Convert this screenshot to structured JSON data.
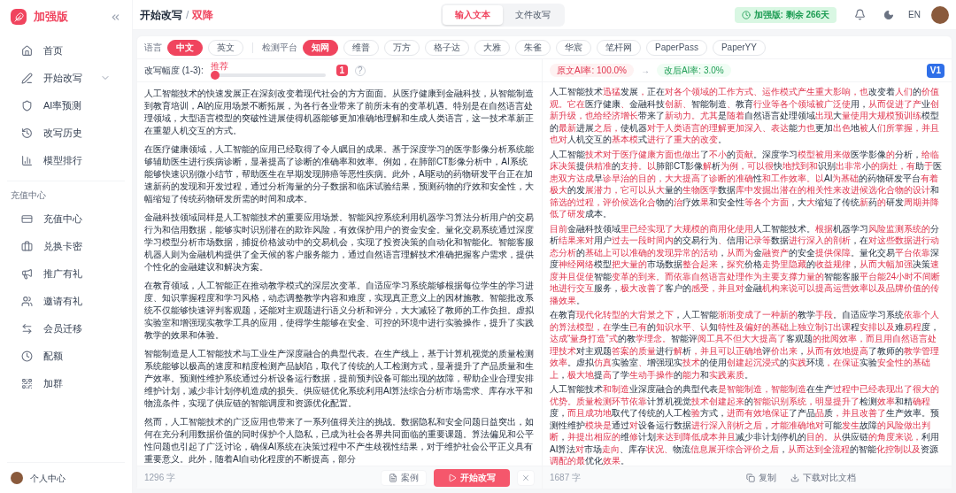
{
  "sidebar": {
    "logo": "加强版",
    "items": [
      {
        "label": "首页",
        "kind": "link",
        "selected": false
      },
      {
        "label": "开始改写",
        "kind": "group",
        "selected": false
      },
      {
        "label": "AI率预测",
        "kind": "link",
        "selected": false
      },
      {
        "label": "改写历史",
        "kind": "link",
        "selected": false
      },
      {
        "label": "模型排行",
        "kind": "link",
        "selected": false
      }
    ],
    "section_label": "充值中心",
    "section_items": [
      {
        "label": "充值中心",
        "selected": false
      },
      {
        "label": "兑换卡密",
        "selected": false
      },
      {
        "label": "推广有礼",
        "selected": false
      },
      {
        "label": "邀请有礼",
        "selected": false
      },
      {
        "label": "会员迁移",
        "selected": false
      },
      {
        "label": "配额",
        "selected": false
      },
      {
        "label": "加群",
        "selected": false
      }
    ],
    "user": "个人中心"
  },
  "header": {
    "breadcrumb": "开始改写",
    "separator": "/",
    "current": "双降",
    "mode_tabs": [
      {
        "label": "输入文本",
        "selected": true
      },
      {
        "label": "文件改写",
        "selected": false
      }
    ],
    "plan_badge": "加强版: 剩余 266天",
    "language_toggle": "EN"
  },
  "filters": {
    "language_label": "语言",
    "languages": [
      {
        "label": "中文",
        "selected": true
      },
      {
        "label": "英文",
        "selected": false
      }
    ],
    "platform_label": "检测平台",
    "platforms": [
      {
        "label": "知网",
        "selected": true
      },
      {
        "label": "维普",
        "selected": false
      },
      {
        "label": "万方",
        "selected": false
      },
      {
        "label": "格子达",
        "selected": false
      },
      {
        "label": "大雅",
        "selected": false
      },
      {
        "label": "朱雀",
        "selected": false
      },
      {
        "label": "华宸",
        "selected": false
      },
      {
        "label": "笔杆网",
        "selected": false
      },
      {
        "label": "PaperPass",
        "selected": false
      },
      {
        "label": "PaperYY",
        "selected": false
      }
    ]
  },
  "input_panel": {
    "strength_label": "改写幅度 (1-3):",
    "strength_hint": "推荐",
    "strength": {
      "level": 0
    },
    "strength_value": "1",
    "help": "?",
    "paragraphs": [
      "人工智能技术的快速发展正在深刻改变着现代社会的方方面面。从医疗健康到金融科技，从智能制造到教育培训，AI的应用场景不断拓展，为各行各业带来了前所未有的变革机遇。特别是在自然语言处理领域，大型语言模型的突破性进展使得机器能够更加准确地理解和生成人类语言，这一技术革新正在重塑人机交互的方式。",
      "在医疗健康领域，人工智能的应用已经取得了令人瞩目的成果。基于深度学习的医学影像分析系统能够辅助医生进行疾病诊断，显著提高了诊断的准确率和效率。例如，在肺部CT影像分析中，AI系统能够快速识别微小结节，帮助医生在早期发现肺癌等恶性疾病。此外，AI驱动的药物研发平台正在加速新药的发现和开发过程，通过分析海量的分子数据和临床试验结果，预测药物的疗效和安全性，大幅缩短了传统药物研发所需的时间和成本。",
      "金融科技领域同样是人工智能技术的重要应用场景。智能风控系统利用机器学习算法分析用户的交易行为和信用数据，能够实时识别潜在的欺诈风险，有效保护用户的资金安全。量化交易系统通过深度学习模型分析市场数据，捕捉价格波动中的交易机会，实现了投资决策的自动化和智能化。智能客服机器人则为金融机构提供了全天候的客户服务能力，通过自然语言理解技术准确把握客户需求，提供个性化的金融建议和解决方案。",
      "在教育领域，人工智能正在推动教学模式的深层次变革。自适应学习系统能够根据每位学生的学习进度、知识掌握程度和学习风格，动态调整教学内容和难度，实现真正意义上的因材施教。智能批改系统不仅能够快速评判客观题，还能对主观题进行语义分析和评分，大大减轻了教师的工作负担。虚拟实验室和增强现实教学工具的应用，使得学生能够在安全、可控的环境中进行实验操作，提升了实践教学的效果和体验。",
      "智能制造是人工智能技术与工业生产深度融合的典型代表。在生产线上，基于计算机视觉的质量检测系统能够以极高的速度和精度检测产品缺陷，取代了传统的人工检测方式，显著提升了产品质量和生产效率。预测性维护系统通过分析设备运行数据，提前预判设备可能出现的故障，帮助企业合理安排维护计划，减少非计划停机造成的损失。供应链优化系统利用AI算法综合分析市场需求、库存水平和物流条件，实现了供应链的智能调度和资源优化配置。",
      "然而，人工智能技术的广泛应用也带来了一系列值得关注的挑战。数据隐私和安全问题日益突出，如何在充分利用数据价值的同时保护个人隐私，已成为社会各界共同面临的重要课题。算法偏见和公平性问题也引起了广泛讨论，确保AI系统在决策过程中不产生歧视性结果，对于维护社会公平正义具有重要意义。此外，随着AI自动化程度的不断提高，部分"
    ],
    "count": "1296 字",
    "sample_button": "案例",
    "start_button": "开始改写"
  },
  "output_panel": {
    "original_rate": "原文AI率: 100.0%",
    "arrow": "→",
    "new_rate": "改后AI率: 3.0%",
    "version": "V1",
    "paragraphs": [
      [
        {
          "text": "人工智能技术",
          "changed": false
        },
        {
          "text": "迅猛",
          "changed": true
        },
        {
          "text": "发展",
          "changed": false
        },
        {
          "text": "，",
          "changed": true
        },
        {
          "text": "正在",
          "changed": false
        },
        {
          "text": "对各个领域的工作方式、运作模式产生重大影响，也",
          "changed": true
        },
        {
          "text": "改变着",
          "changed": false
        },
        {
          "text": "人们",
          "changed": true
        },
        {
          "text": "的",
          "changed": false
        },
        {
          "text": "价值观。它在",
          "changed": true
        },
        {
          "text": "医疗健康",
          "changed": false
        },
        {
          "text": "、",
          "changed": true
        },
        {
          "text": "金融科技",
          "changed": false
        },
        {
          "text": "创新、",
          "changed": true
        },
        {
          "text": "智能制造",
          "changed": false
        },
        {
          "text": "、",
          "changed": true
        },
        {
          "text": "教育",
          "changed": false
        },
        {
          "text": "行业等各个领域被广泛使",
          "changed": true
        },
        {
          "text": "用，",
          "changed": false
        },
        {
          "text": "从而促进了产",
          "changed": true
        },
        {
          "text": "业",
          "changed": false
        },
        {
          "text": "创新升级，也给经济增长",
          "changed": true
        },
        {
          "text": "带来了",
          "changed": false
        },
        {
          "text": "新动力。尤其",
          "changed": true
        },
        {
          "text": "是",
          "changed": false
        },
        {
          "text": "随着",
          "changed": true
        },
        {
          "text": "自然语言处理领域",
          "changed": false
        },
        {
          "text": "出现",
          "changed": true
        },
        {
          "text": "大",
          "changed": false
        },
        {
          "text": "量使用大规模预训练",
          "changed": true
        },
        {
          "text": "模型的",
          "changed": false
        },
        {
          "text": "最新",
          "changed": true
        },
        {
          "text": "进展",
          "changed": false
        },
        {
          "text": "之后，",
          "changed": true
        },
        {
          "text": "使机器",
          "changed": false
        },
        {
          "text": "对于人类语言的理解更加深入、表达",
          "changed": true
        },
        {
          "text": "能",
          "changed": false
        },
        {
          "text": "力也",
          "changed": true
        },
        {
          "text": "更加",
          "changed": false
        },
        {
          "text": "出色",
          "changed": true
        },
        {
          "text": "地",
          "changed": false
        },
        {
          "text": "被",
          "changed": true
        },
        {
          "text": "人",
          "changed": false
        },
        {
          "text": "们所掌握，并且也对",
          "changed": true
        },
        {
          "text": "人机交互的",
          "changed": false
        },
        {
          "text": "基本模",
          "changed": true
        },
        {
          "text": "式",
          "changed": false
        },
        {
          "text": "进行了重大的改变",
          "changed": true
        },
        {
          "text": "。",
          "changed": false
        }
      ],
      [
        {
          "text": "人工智能",
          "changed": false
        },
        {
          "text": "技术对于医疗健康方面也做出",
          "changed": true
        },
        {
          "text": "了",
          "changed": false
        },
        {
          "text": "不小",
          "changed": true
        },
        {
          "text": "的",
          "changed": false
        },
        {
          "text": "贡献",
          "changed": true
        },
        {
          "text": "。深度学习",
          "changed": false
        },
        {
          "text": "模型被用来做",
          "changed": true
        },
        {
          "text": "医学影像",
          "changed": false
        },
        {
          "text": "的",
          "changed": true
        },
        {
          "text": "分析，",
          "changed": false
        },
        {
          "text": "给临床决策",
          "changed": true
        },
        {
          "text": "提",
          "changed": false
        },
        {
          "text": "供精准",
          "changed": true
        },
        {
          "text": "的",
          "changed": false
        },
        {
          "text": "支持。以",
          "changed": true
        },
        {
          "text": "肺部CT影像",
          "changed": false
        },
        {
          "text": "解",
          "changed": true
        },
        {
          "text": "析",
          "changed": false
        },
        {
          "text": "为例，可以很",
          "changed": true
        },
        {
          "text": "快",
          "changed": false
        },
        {
          "text": "地找到和",
          "changed": true
        },
        {
          "text": "识别",
          "changed": false
        },
        {
          "text": "出非常",
          "changed": true
        },
        {
          "text": "小",
          "changed": false
        },
        {
          "text": "的病灶，有",
          "changed": true
        },
        {
          "text": "助",
          "changed": false
        },
        {
          "text": "于",
          "changed": true
        },
        {
          "text": "医",
          "changed": false
        },
        {
          "text": "患双方达成",
          "changed": true
        },
        {
          "text": "早",
          "changed": false
        },
        {
          "text": "诊早治的目的，大大提高了诊断的准确",
          "changed": true
        },
        {
          "text": "性",
          "changed": false
        },
        {
          "text": "和工作效率。以",
          "changed": true
        },
        {
          "text": "AI",
          "changed": false
        },
        {
          "text": "为基础",
          "changed": true
        },
        {
          "text": "的药物研发平台",
          "changed": false
        },
        {
          "text": "有着极大",
          "changed": true
        },
        {
          "text": "的发",
          "changed": false
        },
        {
          "text": "展潜力，它可以从大",
          "changed": true
        },
        {
          "text": "量的",
          "changed": false
        },
        {
          "text": "生物医学",
          "changed": true
        },
        {
          "text": "数据",
          "changed": false
        },
        {
          "text": "库中发掘出潜在的相关性来改进候选化合物的设计",
          "changed": true
        },
        {
          "text": "和",
          "changed": false
        },
        {
          "text": "筛选的过程，评价候选化合",
          "changed": true
        },
        {
          "text": "物的",
          "changed": false
        },
        {
          "text": "治",
          "changed": true
        },
        {
          "text": "疗效",
          "changed": false
        },
        {
          "text": "果",
          "changed": true
        },
        {
          "text": "和安全性",
          "changed": false
        },
        {
          "text": "等各个方面",
          "changed": true
        },
        {
          "text": "，大",
          "changed": false
        },
        {
          "text": "大",
          "changed": true
        },
        {
          "text": "缩短了传统",
          "changed": false
        },
        {
          "text": "新",
          "changed": true
        },
        {
          "text": "药",
          "changed": false
        },
        {
          "text": "的",
          "changed": true
        },
        {
          "text": "研发",
          "changed": false
        },
        {
          "text": "周期并降低了研发",
          "changed": true
        },
        {
          "text": "成本。",
          "changed": false
        }
      ],
      [
        {
          "text": "目前",
          "changed": true
        },
        {
          "text": "金融科技领域",
          "changed": false
        },
        {
          "text": "里已经实现了大规模的商用化使用",
          "changed": true
        },
        {
          "text": "人工智能技术。",
          "changed": false
        },
        {
          "text": "根据",
          "changed": true
        },
        {
          "text": "机器学习",
          "changed": false
        },
        {
          "text": "风险监测系统的",
          "changed": true
        },
        {
          "text": "分析",
          "changed": false
        },
        {
          "text": "结果来对",
          "changed": true
        },
        {
          "text": "用户",
          "changed": false
        },
        {
          "text": "过去一段时间内",
          "changed": true
        },
        {
          "text": "的交易行为",
          "changed": false
        },
        {
          "text": "、",
          "changed": true
        },
        {
          "text": "信用",
          "changed": false
        },
        {
          "text": "记录等",
          "changed": true
        },
        {
          "text": "数据",
          "changed": false
        },
        {
          "text": "进行深入的剖析",
          "changed": true
        },
        {
          "text": "，在",
          "changed": false
        },
        {
          "text": "对这些数据进行动态分析",
          "changed": true
        },
        {
          "text": "的",
          "changed": false
        },
        {
          "text": "基础上可以准确的发现异常的活动",
          "changed": true
        },
        {
          "text": "，",
          "changed": false
        },
        {
          "text": "从而为",
          "changed": true
        },
        {
          "text": "金",
          "changed": false
        },
        {
          "text": "融资产",
          "changed": true
        },
        {
          "text": "的安全",
          "changed": false
        },
        {
          "text": "提供保障",
          "changed": true
        },
        {
          "text": "。量化交易",
          "changed": false
        },
        {
          "text": "平台依靠",
          "changed": true
        },
        {
          "text": "深度",
          "changed": false
        },
        {
          "text": "神经网络",
          "changed": true
        },
        {
          "text": "模型",
          "changed": false
        },
        {
          "text": "把大量的",
          "changed": true
        },
        {
          "text": "市场数据",
          "changed": false
        },
        {
          "text": "整合起来",
          "changed": true
        },
        {
          "text": "，",
          "changed": false
        },
        {
          "text": "探究",
          "changed": true
        },
        {
          "text": "价格",
          "changed": false
        },
        {
          "text": "走势里隐藏",
          "changed": true
        },
        {
          "text": "的",
          "changed": false
        },
        {
          "text": "收益规律",
          "changed": true
        },
        {
          "text": "，",
          "changed": false
        },
        {
          "text": "从而大幅加强",
          "changed": true
        },
        {
          "text": "决策",
          "changed": false
        },
        {
          "text": "速度并且促使",
          "changed": true
        },
        {
          "text": "智能",
          "changed": false
        },
        {
          "text": "变革的到来。而依靠自然语言处理作为主要支撑力量的",
          "changed": true
        },
        {
          "text": "智能客服",
          "changed": false
        },
        {
          "text": "平台能24小时不间断地进行交互",
          "changed": true
        },
        {
          "text": "服务，",
          "changed": false
        },
        {
          "text": "极大改善了",
          "changed": true
        },
        {
          "text": "客户的",
          "changed": false
        },
        {
          "text": "感受，并且对",
          "changed": true
        },
        {
          "text": "金融",
          "changed": false
        },
        {
          "text": "机构来说可以提高运营效率以及品牌价值的传播效果",
          "changed": true
        },
        {
          "text": "。",
          "changed": false
        }
      ],
      [
        {
          "text": "在教育",
          "changed": false
        },
        {
          "text": "现代化转型的大背景之下",
          "changed": true
        },
        {
          "text": "，人工智能",
          "changed": false
        },
        {
          "text": "渐渐变成了一种新的",
          "changed": true
        },
        {
          "text": "教学",
          "changed": false
        },
        {
          "text": "手段",
          "changed": true
        },
        {
          "text": "。自适应学习系统",
          "changed": false
        },
        {
          "text": "依靠个人的算法模型，在",
          "changed": true
        },
        {
          "text": "学生",
          "changed": false
        },
        {
          "text": "已有",
          "changed": true
        },
        {
          "text": "的",
          "changed": false
        },
        {
          "text": "知识水平、认",
          "changed": true
        },
        {
          "text": "知",
          "changed": false
        },
        {
          "text": "特性及偏好的基础上独立制订出课",
          "changed": true
        },
        {
          "text": "程",
          "changed": false
        },
        {
          "text": "安排以及",
          "changed": true
        },
        {
          "text": "难",
          "changed": false
        },
        {
          "text": "易程",
          "changed": true
        },
        {
          "text": "度，",
          "changed": false
        },
        {
          "text": "达成“量身打造”式",
          "changed": true
        },
        {
          "text": "的教",
          "changed": false
        },
        {
          "text": "学理念。",
          "changed": true
        },
        {
          "text": "智能评",
          "changed": false
        },
        {
          "text": "阅工具不但大大提高了",
          "changed": true
        },
        {
          "text": "客观题",
          "changed": false
        },
        {
          "text": "的批阅效率，而且用自然语言处理技术",
          "changed": true
        },
        {
          "text": "对主观题",
          "changed": false
        },
        {
          "text": "答案的质量",
          "changed": true
        },
        {
          "text": "进行",
          "changed": false
        },
        {
          "text": "解",
          "changed": true
        },
        {
          "text": "析",
          "changed": false
        },
        {
          "text": "，并且可以正确地",
          "changed": true
        },
        {
          "text": "评",
          "changed": false
        },
        {
          "text": "价出来",
          "changed": true
        },
        {
          "text": "，",
          "changed": false
        },
        {
          "text": "从而有效地提高",
          "changed": true
        },
        {
          "text": "了教师的",
          "changed": false
        },
        {
          "text": "教学管理效率",
          "changed": true
        },
        {
          "text": "。虚拟",
          "changed": false
        },
        {
          "text": "仿真",
          "changed": true
        },
        {
          "text": "实验室",
          "changed": false
        },
        {
          "text": "、",
          "changed": true
        },
        {
          "text": "增强现实",
          "changed": false
        },
        {
          "text": "技术",
          "changed": true
        },
        {
          "text": "的使用",
          "changed": false
        },
        {
          "text": "创建起沉浸式",
          "changed": true
        },
        {
          "text": "的",
          "changed": false
        },
        {
          "text": "实践",
          "changed": true
        },
        {
          "text": "环境",
          "changed": false
        },
        {
          "text": "，在保证",
          "changed": true
        },
        {
          "text": "实验",
          "changed": false
        },
        {
          "text": "安全性的基础上",
          "changed": true
        },
        {
          "text": "，",
          "changed": false
        },
        {
          "text": "极大地",
          "changed": true
        },
        {
          "text": "提",
          "changed": false
        },
        {
          "text": "高",
          "changed": true
        },
        {
          "text": "了学",
          "changed": false
        },
        {
          "text": "生动手操作",
          "changed": true
        },
        {
          "text": "的",
          "changed": false
        },
        {
          "text": "能力",
          "changed": true
        },
        {
          "text": "和",
          "changed": false
        },
        {
          "text": "实践素质",
          "changed": true
        },
        {
          "text": "。",
          "changed": false
        }
      ],
      [
        {
          "text": "人工智能技术",
          "changed": false
        },
        {
          "text": "和制造",
          "changed": true
        },
        {
          "text": "业深度融合的典型代表",
          "changed": false
        },
        {
          "text": "是智能制造，智能制造",
          "changed": true
        },
        {
          "text": "在生产",
          "changed": false
        },
        {
          "text": "过程中已经表现出了很大的优势。质量检测环节依靠",
          "changed": true
        },
        {
          "text": "计算机视觉",
          "changed": false
        },
        {
          "text": "技术创建起来",
          "changed": true
        },
        {
          "text": "的",
          "changed": false
        },
        {
          "text": "智能识别系统，明显提升了",
          "changed": true
        },
        {
          "text": "检测",
          "changed": false
        },
        {
          "text": "效率",
          "changed": true
        },
        {
          "text": "和精",
          "changed": false
        },
        {
          "text": "确程",
          "changed": true
        },
        {
          "text": "度，",
          "changed": false
        },
        {
          "text": "而且成功地",
          "changed": true
        },
        {
          "text": "取代了传统的人工检",
          "changed": false
        },
        {
          "text": "验",
          "changed": true
        },
        {
          "text": "方式，",
          "changed": false
        },
        {
          "text": "进而有效地保证",
          "changed": true
        },
        {
          "text": "了产品",
          "changed": false
        },
        {
          "text": "品",
          "changed": true
        },
        {
          "text": "质",
          "changed": false
        },
        {
          "text": "，并且改善了",
          "changed": true
        },
        {
          "text": "生产效率。预测性维护",
          "changed": false
        },
        {
          "text": "模块是",
          "changed": true
        },
        {
          "text": "通过",
          "changed": false
        },
        {
          "text": "对",
          "changed": true
        },
        {
          "text": "设备运行数据",
          "changed": false
        },
        {
          "text": "进行深入剖析之后",
          "changed": true
        },
        {
          "text": "，",
          "changed": false
        },
        {
          "text": "才能准确地对",
          "changed": true
        },
        {
          "text": "可能",
          "changed": false
        },
        {
          "text": "发生",
          "changed": true
        },
        {
          "text": "故障",
          "changed": false
        },
        {
          "text": "的风险做出判断",
          "changed": true
        },
        {
          "text": "，",
          "changed": false
        },
        {
          "text": "并提出相应的",
          "changed": true
        },
        {
          "text": "维",
          "changed": false
        },
        {
          "text": "修",
          "changed": true
        },
        {
          "text": "计划",
          "changed": false
        },
        {
          "text": "来达到降低成本并且",
          "changed": true
        },
        {
          "text": "减少非计划停机的",
          "changed": false
        },
        {
          "text": "目的。从",
          "changed": true
        },
        {
          "text": "供应链",
          "changed": false
        },
        {
          "text": "的角度来说，",
          "changed": true
        },
        {
          "text": "利用AI算法",
          "changed": false
        },
        {
          "text": "对",
          "changed": true
        },
        {
          "text": "市场",
          "changed": false
        },
        {
          "text": "走向",
          "changed": true
        },
        {
          "text": "、库存",
          "changed": false
        },
        {
          "text": "状况、",
          "changed": true
        },
        {
          "text": "物流",
          "changed": false
        },
        {
          "text": "信息展开综合评价之后",
          "changed": true
        },
        {
          "text": "，",
          "changed": false
        },
        {
          "text": "从而达到全流程",
          "changed": true
        },
        {
          "text": "的智能",
          "changed": false
        },
        {
          "text": "化控制以及",
          "changed": true
        },
        {
          "text": "资源",
          "changed": false
        },
        {
          "text": "调配的最",
          "changed": true
        },
        {
          "text": "优化",
          "changed": false
        },
        {
          "text": "效果",
          "changed": true
        },
        {
          "text": "。",
          "changed": false
        }
      ]
    ],
    "count": "1687 字",
    "copy_button": "复制",
    "download_button": "下载对比文档"
  }
}
